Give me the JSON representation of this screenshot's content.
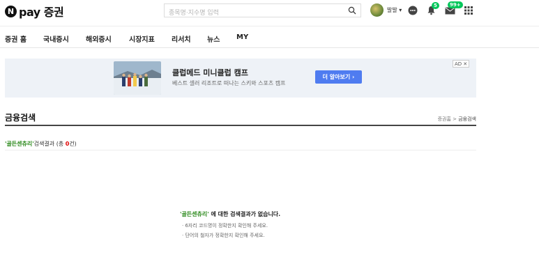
{
  "brand": {
    "logo_letter": "N",
    "logo_text": "pay 증권"
  },
  "search": {
    "placeholder": "종목명·지수명 입력"
  },
  "user": {
    "name": "발발 ▾"
  },
  "badges": {
    "notifications": "5",
    "mail": "99+"
  },
  "nav": {
    "items": [
      {
        "label": "증권 홈"
      },
      {
        "label": "국내증시"
      },
      {
        "label": "해외증시"
      },
      {
        "label": "시장지표"
      },
      {
        "label": "리서치"
      },
      {
        "label": "뉴스"
      },
      {
        "label": "MY"
      }
    ]
  },
  "ad": {
    "title": "클럽메드 미니클럽 캠프",
    "subtitle": "베스트 셀러 리조트로 떠나는 스키와 스포츠 캠프",
    "cta": "더 알아보기 ›",
    "tag": "AD",
    "close": "✕"
  },
  "section": {
    "title": "금융검색",
    "breadcrumb": {
      "home": "증권홈",
      "sep": ">",
      "current": "금융검색"
    }
  },
  "result": {
    "query": "'골든센츄리'",
    "label": "검색결과",
    "count_prefix": " (총 ",
    "count": "0",
    "count_suffix": "건)"
  },
  "empty": {
    "query": "'골든센츄리'",
    "message": " 에 대한 검색결과가 없습니다.",
    "tips": [
      "· 6자리 코드명이 정확한지 확인해 주세요.",
      "· 단어의 철자가 정확한지 확인해 주세요."
    ]
  },
  "colors": {
    "accent_green": "#03c75a",
    "cta_blue": "#4f7cf0",
    "result_red": "#e00000"
  }
}
